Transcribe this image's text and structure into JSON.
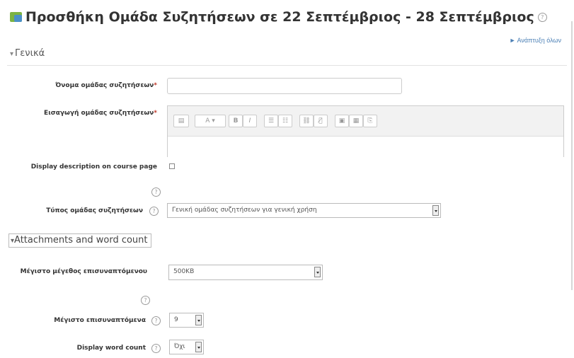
{
  "page": {
    "title": "Προσθήκη Ομάδα Συζητήσεων σε 22 Σεπτέμβριος - 28 Σεπτέμβριος",
    "expand_all": "► Ανάπτυξη όλων"
  },
  "general": {
    "heading": "Γενικά",
    "group_name_label": "Όνομα ομάδας συζητήσεων",
    "group_name_value": "",
    "intro_label": "Εισαγωγή ομάδας συζητήσεων",
    "display_desc_label": "Display description on course page",
    "type_label": "Τύπος ομάδας συζητήσεων",
    "type_value": "Γενική ομάδας συζητήσεων για γενική χρήση"
  },
  "editor_toolbar": [
    "▤",
    "A ▾",
    "B",
    "I",
    "☰",
    "☷",
    "⛓",
    "⛓̸",
    "▣",
    "▦",
    "⎘"
  ],
  "attachments": {
    "heading": "Attachments and word count",
    "max_size_label": "Μέγιστο μέγεθος επισυναπτόμενου",
    "max_size_value": "500KB",
    "max_attach_label": "Μέγιστο επισυναπτόμενα",
    "max_attach_value": "9",
    "word_count_label": "Display word count",
    "word_count_value": "Όχι"
  },
  "colors": {
    "title_text": "#333333",
    "link": "#4a7fb5",
    "required": "#c0392b"
  },
  "icons": {
    "title": "forum-icon",
    "help": "help-icon",
    "collapse": "triangle-down-icon"
  }
}
